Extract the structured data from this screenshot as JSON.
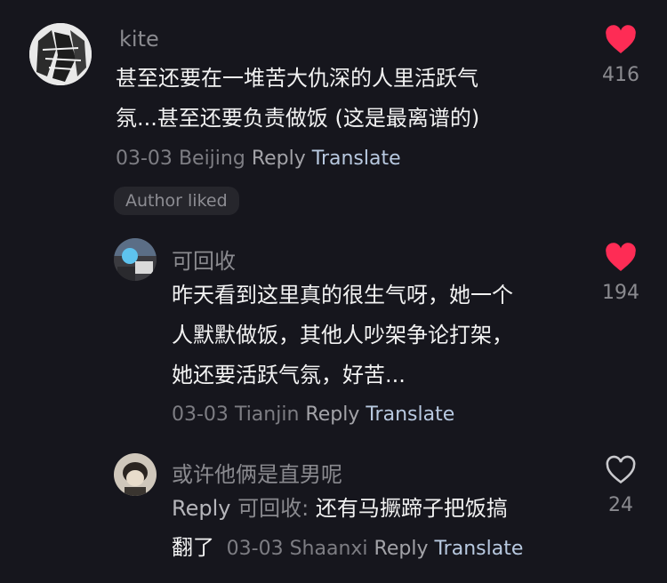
{
  "comments": [
    {
      "username": "kite",
      "text_line1": "甚至还要在一堆苦大仇深的人里活跃气",
      "text_line2": "氛...甚至还要负责做饭 (这是最离谱的)",
      "date": "03-03",
      "location": "Beijing",
      "reply_label": "Reply",
      "translate_label": "Translate",
      "likes": "416",
      "liked": true,
      "badge": "Author liked"
    },
    {
      "username": "可回收",
      "text_line1": "昨天看到这里真的很生气呀，她一个",
      "text_line2": "人默默做饭，其他人吵架争论打架，",
      "text_line3": "她还要活跃气氛，好苦...",
      "date": "03-03",
      "location": "Tianjin",
      "reply_label": "Reply",
      "translate_label": "Translate",
      "likes": "194",
      "liked": true
    },
    {
      "username": "或许他俩是直男呢",
      "reply_prefix": "Reply",
      "reply_to": "可回收:",
      "text_line1": "还有马撅蹄子把饭搞",
      "text_line2": "翻了",
      "date": "03-03",
      "location": "Shaanxi",
      "reply_label": "Reply",
      "translate_label": "Translate",
      "likes": "24",
      "liked": false
    }
  ],
  "colors": {
    "background": "#16161d",
    "heart_liked": "#fe2c55",
    "translate_link": "#b8c9e0"
  }
}
